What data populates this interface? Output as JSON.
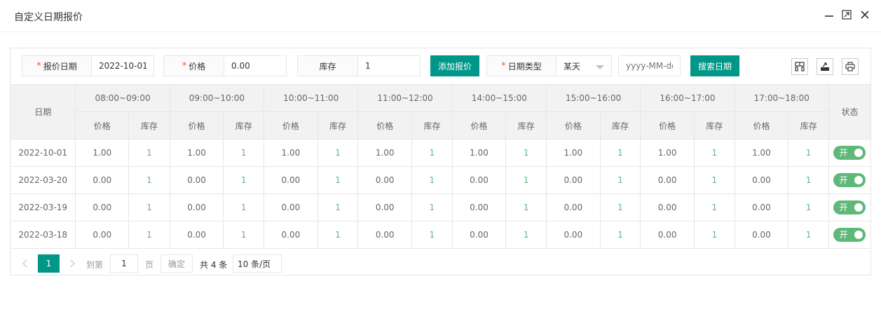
{
  "window": {
    "title": "自定义日期报价"
  },
  "toolbar": {
    "date_label": "报价日期",
    "date_value": "2022-10-01",
    "price_label": "价格",
    "price_value": "0.00",
    "stock_label": "库存",
    "stock_value": "1",
    "add_button": "添加报价",
    "date_type_label": "日期类型",
    "date_type_value": "某天",
    "date_placeholder": "yyyy-MM-dd",
    "search_button": "搜索日期",
    "required_mark": "*"
  },
  "table": {
    "date_header": "日期",
    "status_header": "状态",
    "price_sub": "价格",
    "stock_sub": "库存",
    "slots": [
      "08:00~09:00",
      "09:00~10:00",
      "10:00~11:00",
      "11:00~12:00",
      "14:00~15:00",
      "15:00~16:00",
      "16:00~17:00",
      "17:00~18:00"
    ],
    "rows": [
      {
        "date": "2022-10-01",
        "cells": [
          [
            "1.00",
            "1"
          ],
          [
            "1.00",
            "1"
          ],
          [
            "1.00",
            "1"
          ],
          [
            "1.00",
            "1"
          ],
          [
            "1.00",
            "1"
          ],
          [
            "1.00",
            "1"
          ],
          [
            "1.00",
            "1"
          ],
          [
            "1.00",
            "1"
          ]
        ],
        "status": "开"
      },
      {
        "date": "2022-03-20",
        "cells": [
          [
            "0.00",
            "1"
          ],
          [
            "0.00",
            "1"
          ],
          [
            "0.00",
            "1"
          ],
          [
            "0.00",
            "1"
          ],
          [
            "0.00",
            "1"
          ],
          [
            "0.00",
            "1"
          ],
          [
            "0.00",
            "1"
          ],
          [
            "0.00",
            "1"
          ]
        ],
        "status": "开"
      },
      {
        "date": "2022-03-19",
        "cells": [
          [
            "0.00",
            "1"
          ],
          [
            "0.00",
            "1"
          ],
          [
            "0.00",
            "1"
          ],
          [
            "0.00",
            "1"
          ],
          [
            "0.00",
            "1"
          ],
          [
            "0.00",
            "1"
          ],
          [
            "0.00",
            "1"
          ],
          [
            "0.00",
            "1"
          ]
        ],
        "status": "开"
      },
      {
        "date": "2022-03-18",
        "cells": [
          [
            "0.00",
            "1"
          ],
          [
            "0.00",
            "1"
          ],
          [
            "0.00",
            "1"
          ],
          [
            "0.00",
            "1"
          ],
          [
            "0.00",
            "1"
          ],
          [
            "0.00",
            "1"
          ],
          [
            "0.00",
            "1"
          ],
          [
            "0.00",
            "1"
          ]
        ],
        "status": "开"
      }
    ]
  },
  "pager": {
    "current_page": "1",
    "goto_label": "到第",
    "goto_value": "1",
    "page_unit": "页",
    "confirm": "确定",
    "total": "共 4 条",
    "page_size": "10 条/页"
  },
  "colors": {
    "accent": "#009688",
    "switch_on": "#5fb878",
    "required": "#ff5722"
  },
  "icons": [
    "minimize-icon",
    "maximize-icon",
    "close-icon",
    "columns-icon",
    "export-icon",
    "print-icon",
    "chevron-left-icon",
    "chevron-right-icon",
    "caret-down-icon"
  ]
}
